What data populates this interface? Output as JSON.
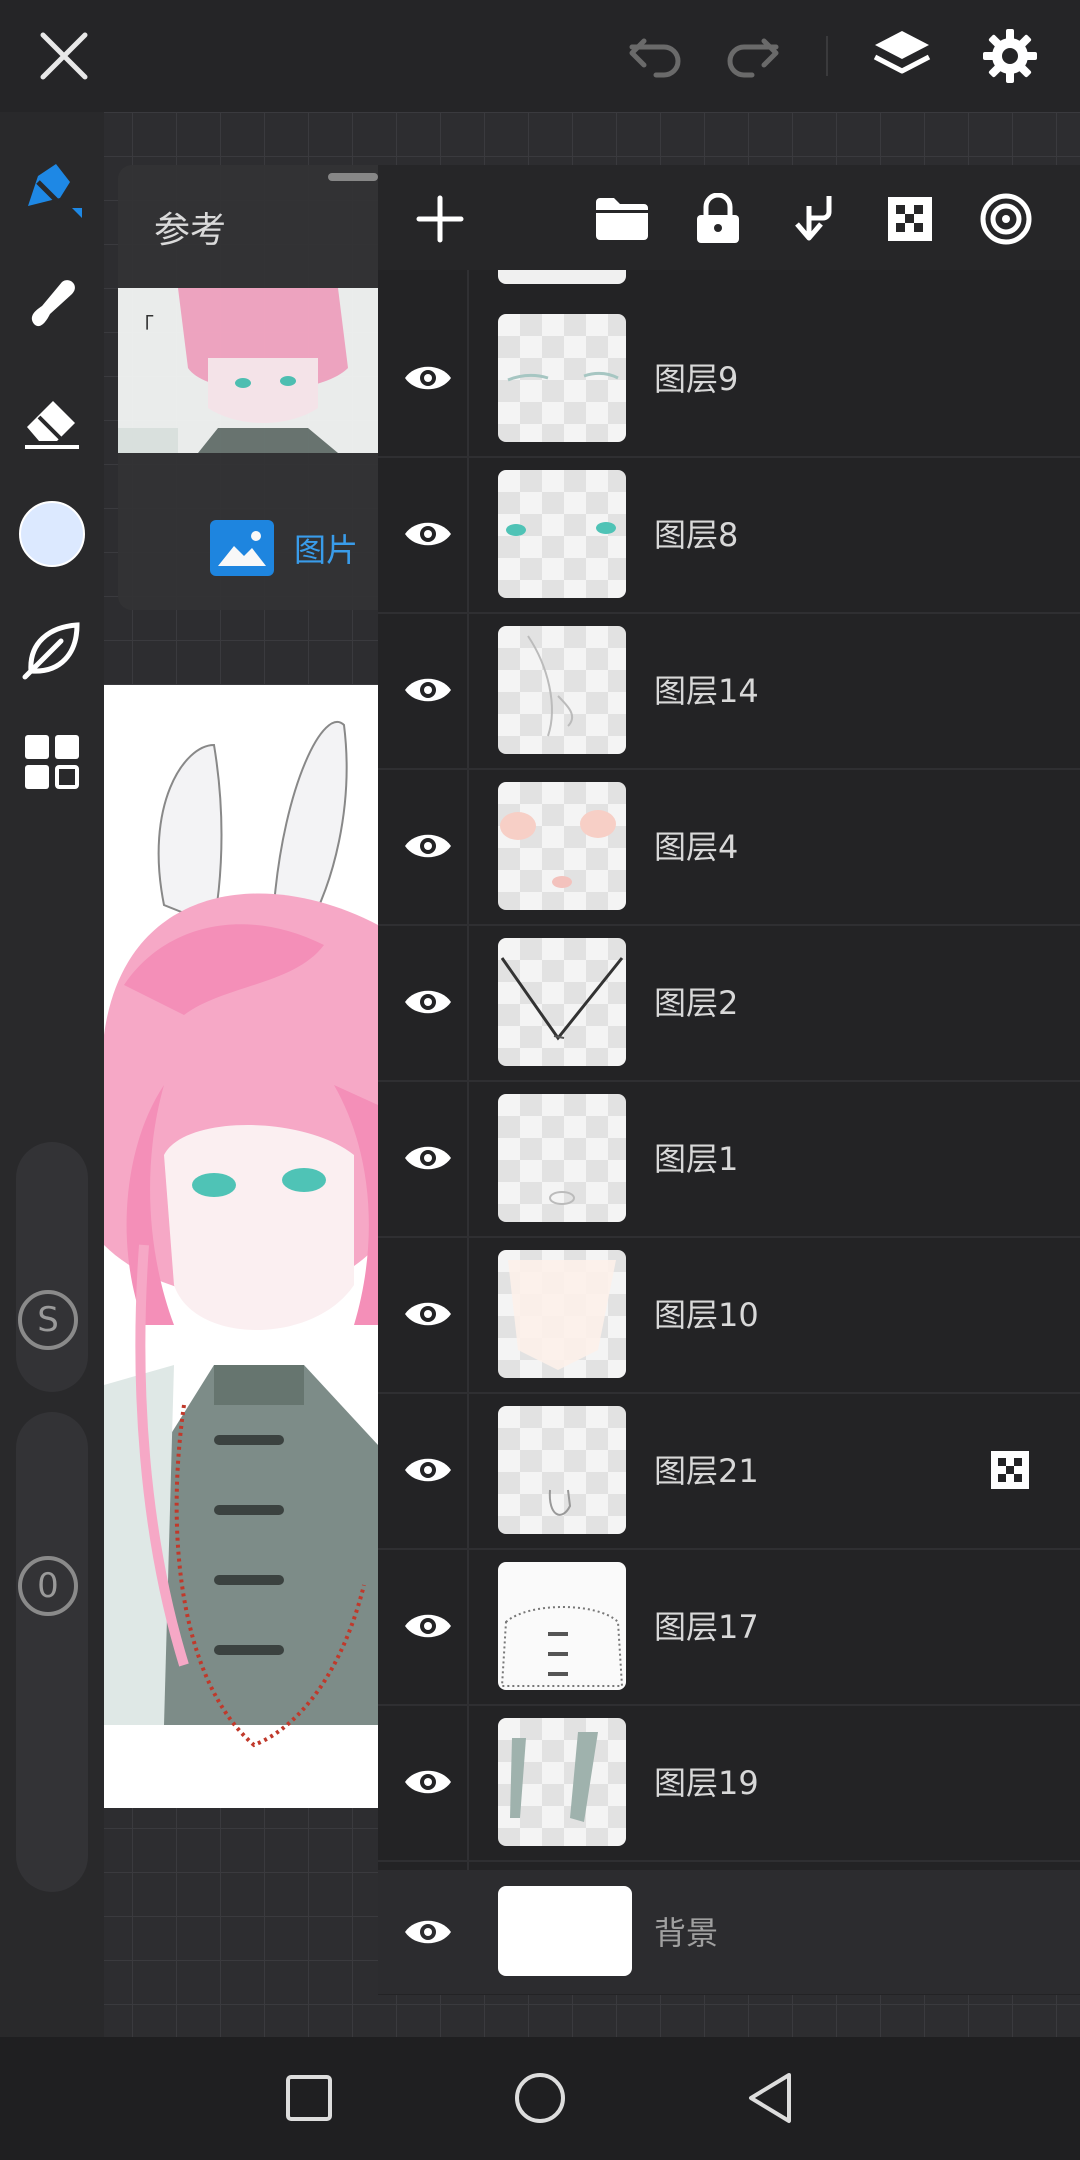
{
  "reference": {
    "title": "参考",
    "picture_label": "图片"
  },
  "layers": [
    {
      "name": "图层9",
      "alpha_lock": false
    },
    {
      "name": "图层8",
      "alpha_lock": false
    },
    {
      "name": "图层14",
      "alpha_lock": false
    },
    {
      "name": "图层4",
      "alpha_lock": false
    },
    {
      "name": "图层2",
      "alpha_lock": false
    },
    {
      "name": "图层1",
      "alpha_lock": false
    },
    {
      "name": "图层10",
      "alpha_lock": false
    },
    {
      "name": "图层21",
      "alpha_lock": true
    },
    {
      "name": "图层17",
      "alpha_lock": false
    },
    {
      "name": "图层19",
      "alpha_lock": false
    }
  ],
  "background_layer": {
    "name": "背景"
  },
  "slider_labels": {
    "size": "S",
    "opacity": "0"
  },
  "colors": {
    "accent": "#1e88e5",
    "current_color": "#dce9ff",
    "reference_link": "#3aa0f0"
  },
  "icons": [
    "close-icon",
    "undo-icon",
    "redo-icon",
    "layers-icon",
    "settings-icon",
    "brush-icon",
    "smudge-icon",
    "eraser-icon",
    "color-icon",
    "leaf-icon",
    "grid-icon",
    "add-layer-icon",
    "folder-icon",
    "lock-icon",
    "merge-down-icon",
    "alpha-lock-icon",
    "blend-icon",
    "eye-icon",
    "image-icon"
  ]
}
